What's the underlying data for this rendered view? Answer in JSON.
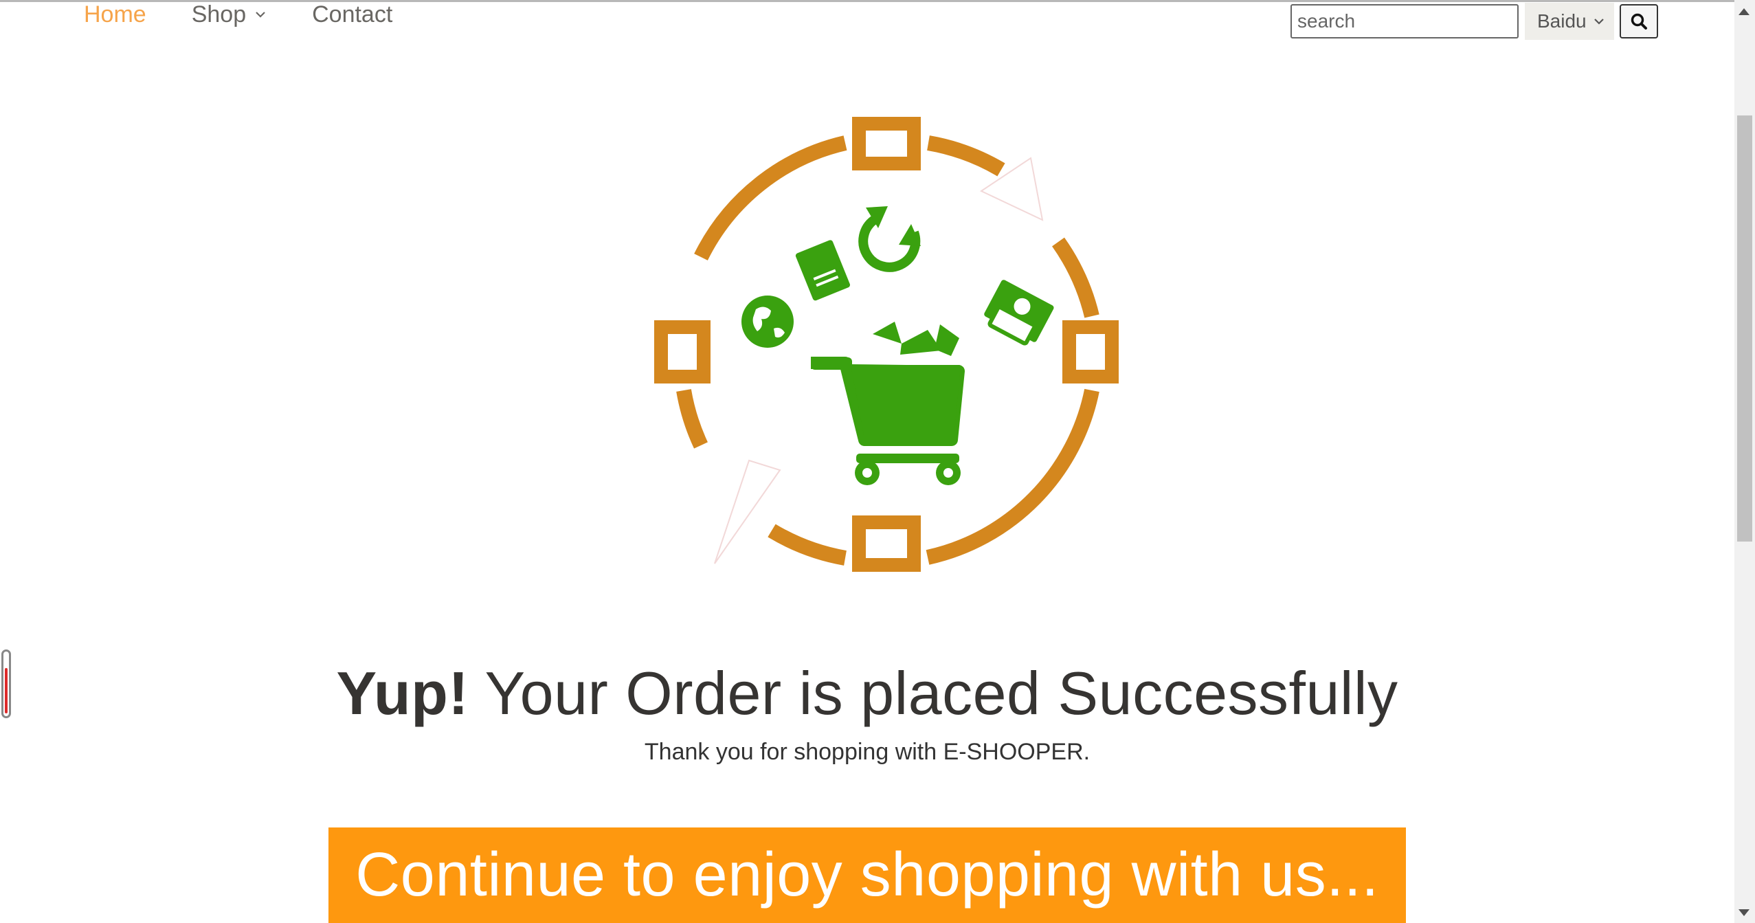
{
  "nav": {
    "items": [
      {
        "label": "Home",
        "active": true
      },
      {
        "label": "Shop",
        "dropdown": true
      },
      {
        "label": "Contact"
      }
    ]
  },
  "search": {
    "placeholder": "search",
    "engine_selected": "Baidu",
    "button_icon": "magnifier-icon"
  },
  "success": {
    "headline_bold": "Yup!",
    "headline_rest": " Your Order is placed Successfully",
    "subtext": "Thank you for shopping with E-SHOOPER."
  },
  "cta": {
    "label": "Continue to enjoy shopping with us..."
  },
  "colors": {
    "accent_orange": "#FE980F",
    "nav_active": "#F6A44A",
    "ring_orange": "#D4871E",
    "icon_green": "#3AA10F"
  }
}
